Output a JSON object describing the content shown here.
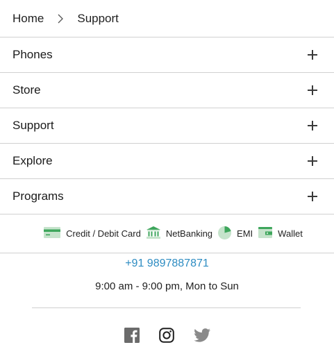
{
  "breadcrumb": {
    "home": "Home",
    "current": "Support"
  },
  "accordion": {
    "items": [
      {
        "label": "Phones"
      },
      {
        "label": "Store"
      },
      {
        "label": "Support"
      },
      {
        "label": "Explore"
      },
      {
        "label": "Programs"
      }
    ]
  },
  "payments": {
    "card": "Credit / Debit Card",
    "netbanking": "NetBanking",
    "emi": "EMI",
    "wallet": "Wallet",
    "icon_color": "#3ea65c",
    "icon_color_light": "#c5e3cb"
  },
  "contact": {
    "phone": "+91 9897887871",
    "hours": "9:00 am - 9:00 pm, Mon to Sun",
    "link_color": "#2d8cc2"
  },
  "social": {
    "icons": [
      "facebook-icon",
      "instagram-icon",
      "twitter-icon"
    ]
  }
}
